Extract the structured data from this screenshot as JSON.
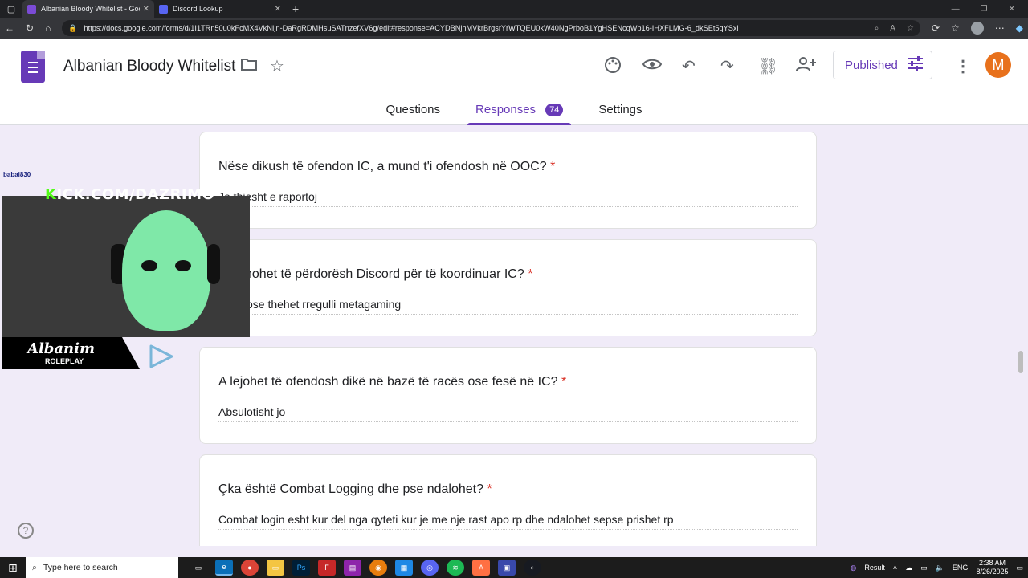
{
  "browser": {
    "tabs": [
      {
        "title": "Albanian Bloody Whitelist - Goog",
        "active": true,
        "favicon_color": "#7b4bd6"
      },
      {
        "title": "Discord Lookup",
        "active": false,
        "favicon_color": "#5865f2"
      }
    ],
    "url": "https://docs.google.com/forms/d/1I1TRn50u0kFcMX4VkNIjn-DaRgRDMHsuSATnzefXV6g/edit#response=ACYDBNjhMVkrBrgsrYrWTQEU0kW40NgPrboB1YgHSENcqWp16-IHXFLMG-6_dkSEt5qYSxl"
  },
  "form": {
    "title": "Albanian Bloody Whitelist",
    "publish_label": "Published",
    "avatar_letter": "M",
    "tabs": {
      "questions": "Questions",
      "responses": "Responses",
      "responses_count": "74",
      "settings": "Settings"
    },
    "accent": "#673ab7",
    "cards": [
      {
        "question": "Nëse dikush të ofendon IC, a mund t'i ofendosh në OOC?",
        "answer": "Jo thjesht e raportoj"
      },
      {
        "question": "hohet të përdorësh Discord për të koordinuar IC?",
        "answer": "ose thehet rregulli metagaming"
      },
      {
        "question": "A lejohet të ofendosh dikë në bazë të racës ose fesë në IC?",
        "answer": "Absulotisht jo"
      },
      {
        "question": "Çka është Combat Logging dhe pse ndalohet?",
        "answer": "Combat login esht kur del nga qyteti kur je me nje rast apo rp dhe ndalohet sepse prishet rp"
      }
    ],
    "required_mark": "*"
  },
  "overlay": {
    "username": "babai830",
    "kick_k": "K",
    "kick_url": "ICK.COM/DAZRIMO",
    "brand_main": "Albanim",
    "brand_sub": "ROLEPLAY"
  },
  "taskbar": {
    "search_placeholder": "Type here to search",
    "weather": "Result",
    "lang": "ENG",
    "time": "2:38 AM",
    "date": "8/26/2025"
  }
}
